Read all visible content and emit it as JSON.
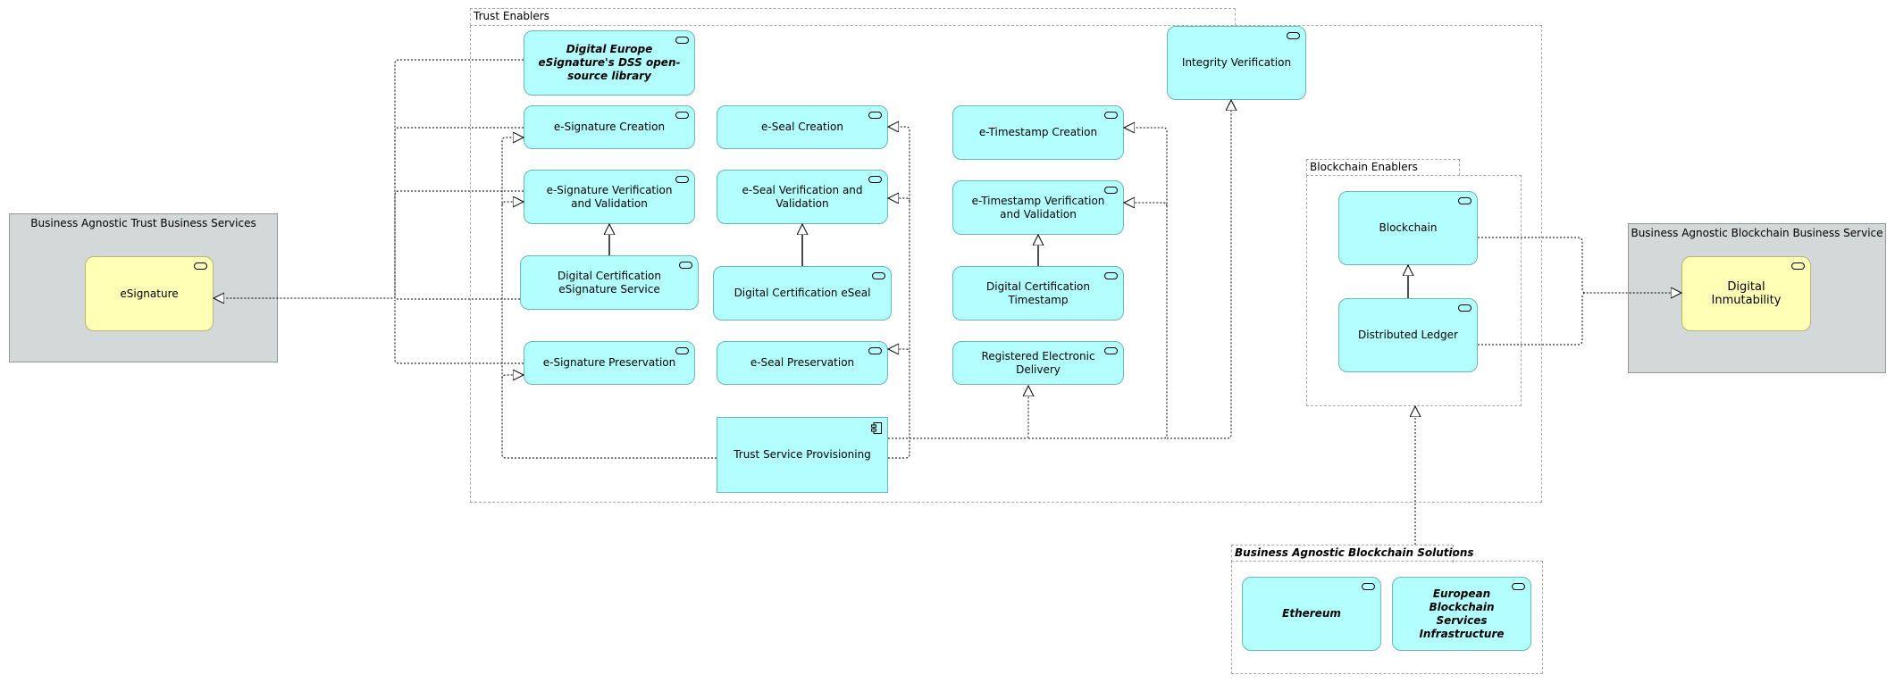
{
  "groups": {
    "trust_enablers": "Trust Enablers",
    "blockchain_enablers": "Blockchain Enablers",
    "blockchain_solutions": "Business Agnostic Blockchain Solutions",
    "trust_business_services": "Business Agnostic Trust Business Services",
    "blockchain_business_service": "Business Agnostic Blockchain Business Service"
  },
  "business_services": {
    "esignature": "eSignature",
    "digital_inmutability": "Digital Inmutability"
  },
  "trust_services": {
    "dss_library": "Digital Europe eSignature's DSS open-source library",
    "esig_creation": "e-Signature Creation",
    "esig_verification": "e-Signature Verification and Validation",
    "esig_certification": "Digital Certification eSignature Service",
    "esig_preservation": "e-Signature Preservation",
    "eseal_creation": "e-Seal Creation",
    "eseal_verification": "e-Seal Verification and Validation",
    "eseal_certification": "Digital Certification eSeal",
    "eseal_preservation": "e-Seal Preservation",
    "etimestamp_creation": "e-Timestamp Creation",
    "etimestamp_verification": "e-Timestamp Verification and Validation",
    "timestamp_certification": "Digital Certification Timestamp",
    "registered_delivery": "Registered Electronic Delivery",
    "integrity_verification": "Integrity Verification",
    "trust_provisioning": "Trust Service Provisioning"
  },
  "blockchain_services": {
    "blockchain": "Blockchain",
    "distributed_ledger": "Distributed Ledger",
    "ethereum": "Ethereum",
    "ebsi": "European Blockchain Services Infrastructure"
  },
  "colors": {
    "application_service": "#b3ffff",
    "business_service": "#ffffb5",
    "grouping_container": "#d3d8d8"
  }
}
